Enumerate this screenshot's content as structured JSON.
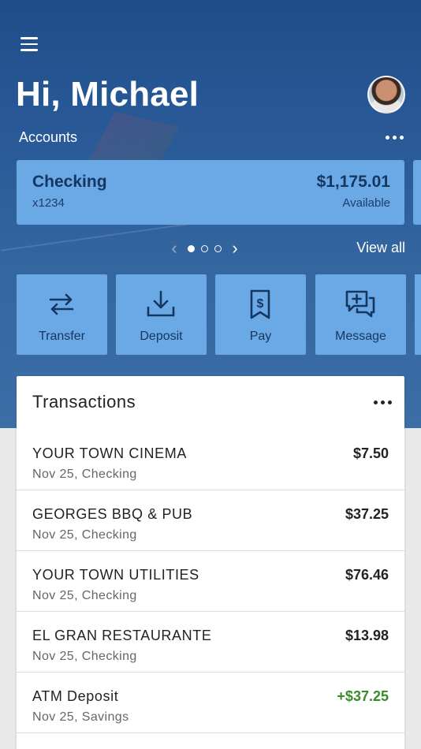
{
  "header": {
    "greeting": "Hi, Michael",
    "accounts_label": "Accounts"
  },
  "account": {
    "name": "Checking",
    "number": "x1234",
    "balance": "$1,175.01",
    "balance_label": "Available"
  },
  "pager": {
    "page": 1,
    "pages": 3,
    "view_all": "View all"
  },
  "actions": [
    {
      "label": "Transfer",
      "icon": "transfer-icon"
    },
    {
      "label": "Deposit",
      "icon": "deposit-icon"
    },
    {
      "label": "Pay",
      "icon": "pay-icon"
    },
    {
      "label": "Message",
      "icon": "message-icon"
    }
  ],
  "transactions": {
    "title": "Transactions",
    "items": [
      {
        "merchant": "YOUR TOWN CINEMA",
        "meta": "Nov 25, Checking",
        "amount": "$7.50",
        "credit": false
      },
      {
        "merchant": "GEORGES BBQ & PUB",
        "meta": "Nov 25, Checking",
        "amount": "$37.25",
        "credit": false
      },
      {
        "merchant": "YOUR TOWN UTILITIES",
        "meta": "Nov 25, Checking",
        "amount": "$76.46",
        "credit": false
      },
      {
        "merchant": "EL GRAN RESTAURANTE",
        "meta": "Nov 25, Checking",
        "amount": "$13.98",
        "credit": false
      },
      {
        "merchant": "ATM Deposit",
        "meta": "Nov 25, Savings",
        "amount": "+$37.25",
        "credit": true
      }
    ]
  },
  "colors": {
    "hero": "#2a5b98",
    "card": "#6aa8e6",
    "credit": "#3b8a2a"
  }
}
